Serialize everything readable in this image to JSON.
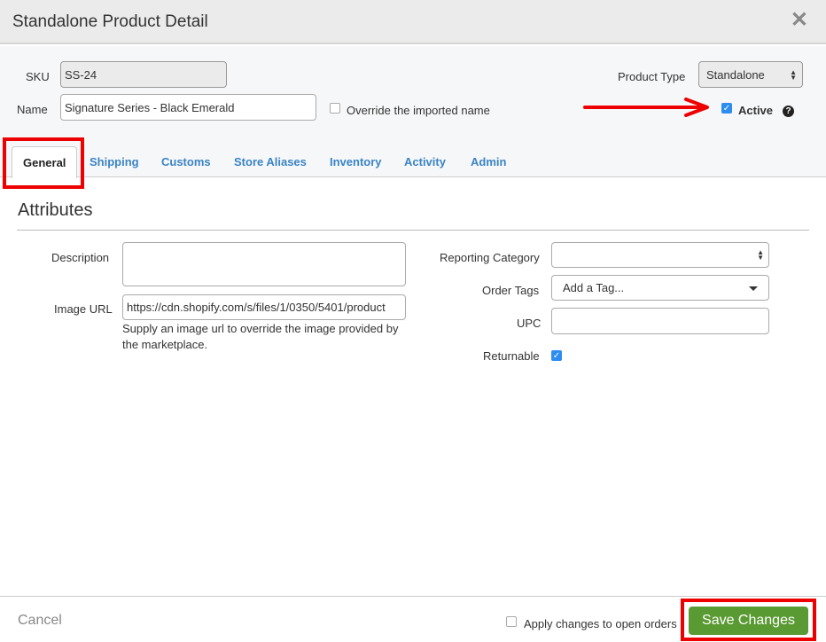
{
  "header": {
    "title": "Standalone Product Detail",
    "close_icon": "close-icon"
  },
  "form": {
    "sku_label": "SKU",
    "sku_value": "SS-24",
    "name_label": "Name",
    "name_value": "Signature Series - Black Emerald",
    "override_label": "Override the imported name",
    "override_checked": false,
    "product_type_label": "Product Type",
    "product_type_value": "Standalone",
    "active_label": "Active",
    "active_checked": true,
    "help_icon": "?"
  },
  "tabs": [
    {
      "label": "General",
      "active": true
    },
    {
      "label": "Shipping",
      "active": false
    },
    {
      "label": "Customs",
      "active": false
    },
    {
      "label": "Store Aliases",
      "active": false
    },
    {
      "label": "Inventory",
      "active": false
    },
    {
      "label": "Activity",
      "active": false
    },
    {
      "label": "Admin",
      "active": false
    }
  ],
  "attributes": {
    "title": "Attributes",
    "description_label": "Description",
    "description_value": "",
    "image_url_label": "Image URL",
    "image_url_value": "https://cdn.shopify.com/s/files/1/0350/5401/product",
    "image_url_help": "Supply an image url to override the image provided by the marketplace.",
    "reporting_category_label": "Reporting Category",
    "reporting_category_value": "",
    "order_tags_label": "Order Tags",
    "order_tags_placeholder": "Add a Tag...",
    "upc_label": "UPC",
    "upc_value": "",
    "returnable_label": "Returnable",
    "returnable_checked": true
  },
  "footer": {
    "cancel_label": "Cancel",
    "apply_label": "Apply changes to open orders",
    "apply_checked": false,
    "save_label": "Save Changes"
  },
  "colors": {
    "accent": "#3a84c4",
    "save": "#5a9a32",
    "annotation": "#e00000",
    "checkbox": "#2d8cf0"
  }
}
